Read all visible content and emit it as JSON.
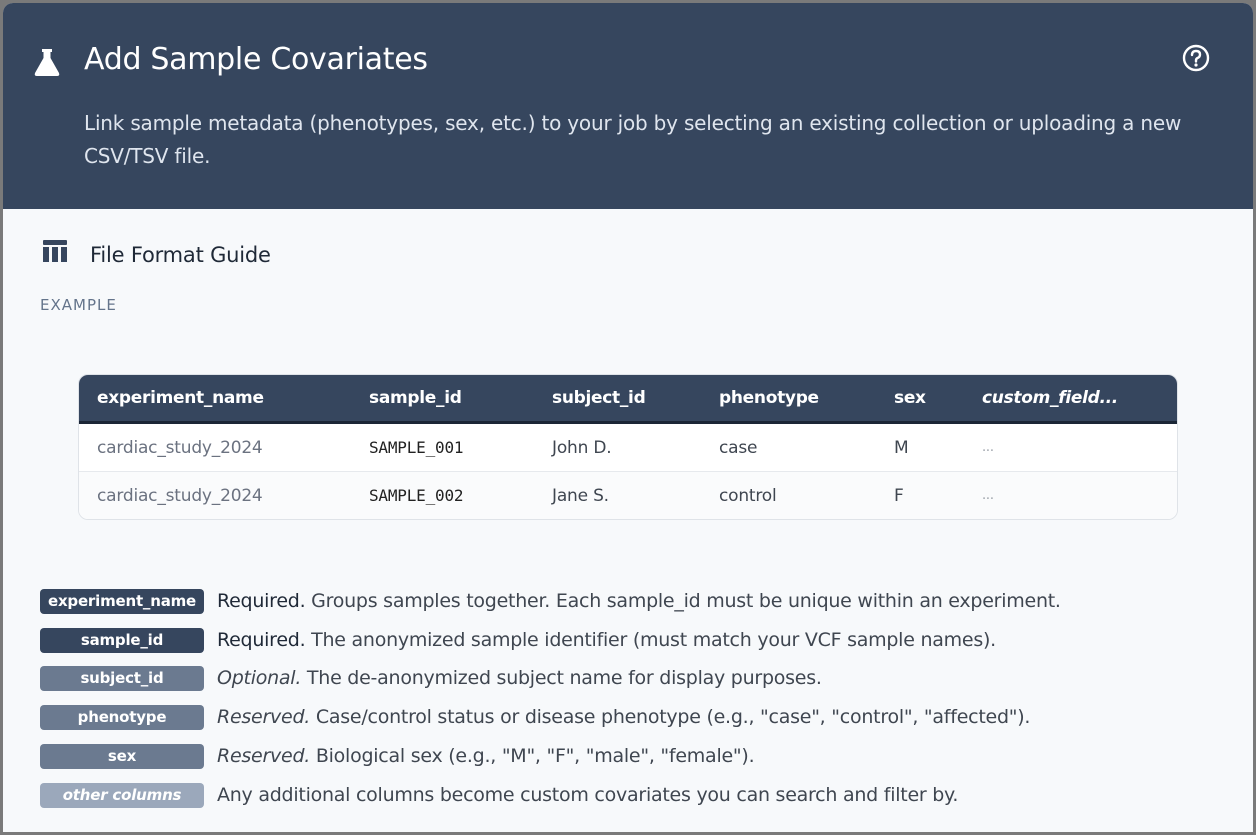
{
  "header": {
    "icon": "flask-icon",
    "title": "Add Sample Covariates",
    "description": "Link sample metadata (phenotypes, sex, etc.) to your job by selecting an existing collection or uploading a new CSV/TSV file.",
    "help_icon": "help-circle-icon"
  },
  "guide": {
    "icon": "table-icon",
    "title": "File Format Guide",
    "example_label": "EXAMPLE",
    "columns": [
      "experiment_name",
      "sample_id",
      "subject_id",
      "phenotype",
      "sex",
      "custom_field..."
    ],
    "rows": [
      [
        "cardiac_study_2024",
        "SAMPLE_001",
        "John D.",
        "case",
        "M",
        "..."
      ],
      [
        "cardiac_study_2024",
        "SAMPLE_002",
        "Jane S.",
        "control",
        "F",
        "..."
      ]
    ]
  },
  "legend": [
    {
      "badge": "experiment_name",
      "tag": "Required.",
      "text": " Groups samples together. Each sample_id must be unique within an experiment."
    },
    {
      "badge": "sample_id",
      "tag": "Required.",
      "text": " The anonymized sample identifier (must match your VCF sample names)."
    },
    {
      "badge": "subject_id",
      "tag": "Optional.",
      "text": " The de-anonymized subject name for display purposes."
    },
    {
      "badge": "phenotype",
      "tag": "Reserved.",
      "text": " Case/control status or disease phenotype (e.g., \"case\", \"control\", \"affected\")."
    },
    {
      "badge": "sex",
      "tag": "Reserved.",
      "text": " Biological sex (e.g., \"M\", \"F\", \"male\", \"female\")."
    },
    {
      "badge": "other columns",
      "tag": "",
      "text": "Any additional columns become custom covariates you can search and filter by."
    }
  ],
  "colors": {
    "header_bg": "#36465e",
    "badge_required": "#36465e",
    "badge_optional": "#6b7a90",
    "badge_other": "#9ba8bb"
  }
}
